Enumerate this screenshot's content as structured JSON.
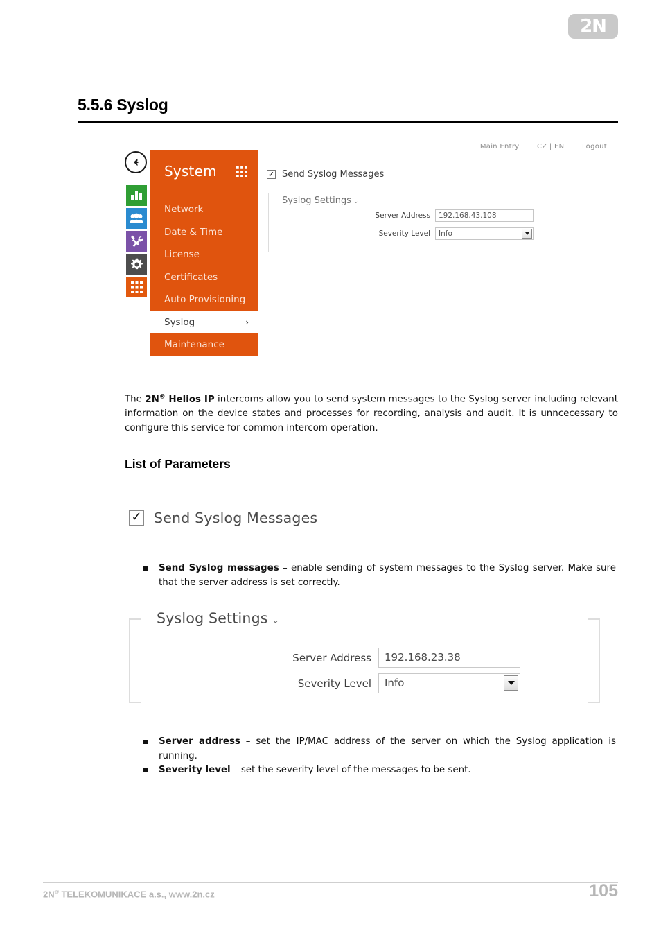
{
  "header": {
    "logo_text": "2N"
  },
  "section": {
    "number_title": "5.5.6 Syslog"
  },
  "console_screenshot": {
    "topnav": {
      "main_entry": "Main Entry",
      "language": "CZ | EN",
      "logout": "Logout"
    },
    "menu": {
      "title": "System",
      "items": [
        {
          "label": "Network",
          "active": false
        },
        {
          "label": "Date & Time",
          "active": false
        },
        {
          "label": "License",
          "active": false
        },
        {
          "label": "Certificates",
          "active": false
        },
        {
          "label": "Auto Provisioning",
          "active": false
        },
        {
          "label": "Syslog",
          "active": true,
          "chevron": "›"
        },
        {
          "label": "Maintenance",
          "active": false
        }
      ],
      "accent_color": "#e0540e",
      "active_bg": "#ffffff"
    },
    "rail_icons": [
      {
        "name": "bar-chart-icon",
        "color": "#2f9e34"
      },
      {
        "name": "users-icon",
        "color": "#2a8bd0"
      },
      {
        "name": "tools-icon",
        "color": "#7b52a8"
      },
      {
        "name": "gear-icon",
        "color": "#4d4d4d"
      },
      {
        "name": "grid-icon",
        "color": "#e2590e"
      }
    ],
    "form": {
      "send_syslog_label": "Send Syslog Messages",
      "send_syslog_checked": true,
      "legend": "Syslog Settings",
      "legend_caret": "⌄",
      "server_address_label": "Server Address",
      "server_address_value": "192.168.43.108",
      "severity_level_label": "Severity Level",
      "severity_level_value": "Info"
    }
  },
  "intro": {
    "prefix": "The ",
    "brand": "2N",
    "brand_sup": "®",
    "brand_rest": " Helios IP",
    "rest": " intercoms allow you to send system messages to the Syslog server including relevant information on the device states and processes for recording, analysis and audit. It is unncecessary to configure this service for common intercom operation."
  },
  "params": {
    "heading": "List of Parameters"
  },
  "big_checkbox": {
    "label": "Send Syslog Messages",
    "checked": true
  },
  "bullets_group_1": [
    {
      "term": "Send Syslog messages",
      "desc": " – enable sending of system messages to the Syslog server. Make sure that the server address is set correctly."
    }
  ],
  "big_panel": {
    "legend": "Syslog Settings",
    "legend_caret": "⌄",
    "server_address_label": "Server Address",
    "server_address_value": "192.168.23.38",
    "severity_level_label": "Severity Level",
    "severity_level_value": "Info"
  },
  "bullets_group_2": [
    {
      "term": "Server address",
      "desc": " – set the IP/MAC address of the server on which the Syslog application is running."
    },
    {
      "term": "Severity level",
      "desc": " – set the severity level of the messages to be sent."
    }
  ],
  "footer": {
    "company": "2N",
    "company_sup": "®",
    "company_rest": " TELEKOMUNIKACE a.s., www.2n.cz",
    "page_number": "105"
  }
}
